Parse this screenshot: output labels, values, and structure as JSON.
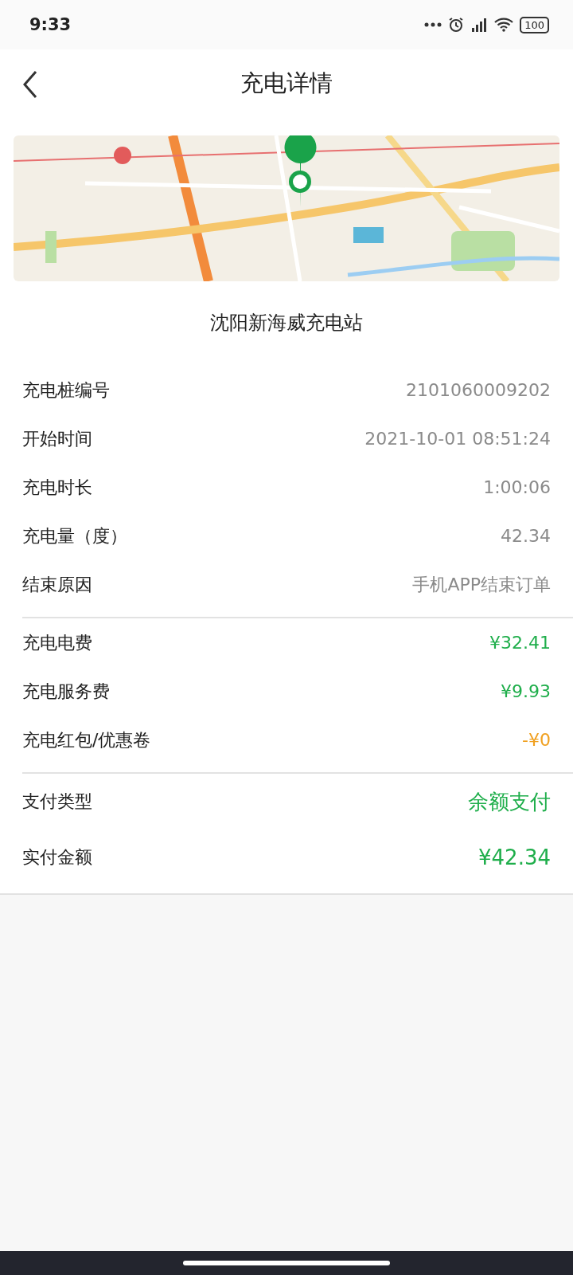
{
  "status_bar": {
    "time": "9:33",
    "battery": "100"
  },
  "header": {
    "title": "充电详情"
  },
  "station": "沈阳新海威充电站",
  "sections": [
    {
      "kind": "normal",
      "rows": [
        {
          "label": "充电桩编号",
          "value": "2101060009202",
          "color": "#8a8a8a"
        },
        {
          "label": "开始时间",
          "value": "2021-10-01 08:51:24",
          "color": "#8a8a8a"
        },
        {
          "label": "充电时长",
          "value": "1:00:06",
          "color": "#8a8a8a"
        },
        {
          "label": "充电量（度）",
          "value": "42.34",
          "color": "#8a8a8a"
        },
        {
          "label": "结束原因",
          "value": "手机APP结束订单",
          "color": "#8a8a8a"
        }
      ]
    },
    {
      "kind": "normal",
      "rows": [
        {
          "label": "充电电费",
          "value": "¥32.41",
          "color": "#1fae4b"
        },
        {
          "label": "充电服务费",
          "value": "¥9.93",
          "color": "#1fae4b"
        },
        {
          "label": "充电红包/优惠卷",
          "value": "-¥0",
          "color": "#f0a020"
        }
      ]
    },
    {
      "kind": "large",
      "rows": [
        {
          "label": "支付类型",
          "value": "余额支付",
          "color": "#1fae4b"
        },
        {
          "label": "实付金额",
          "value": "¥42.34",
          "color": "#1fae4b"
        }
      ]
    }
  ]
}
